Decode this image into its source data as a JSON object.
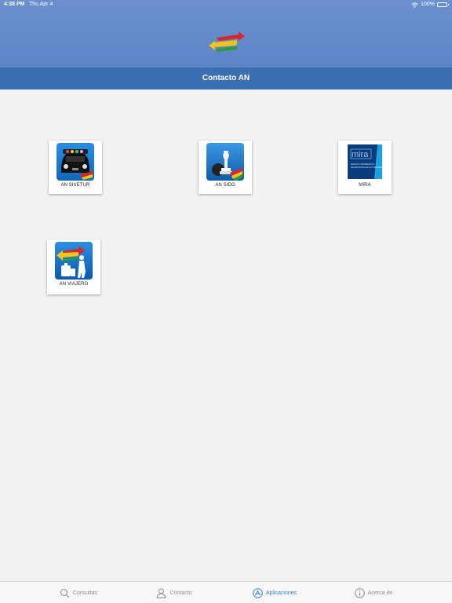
{
  "status": {
    "time": "4:38 PM",
    "date": "Thu Apr 4",
    "battery": "100%"
  },
  "header": {
    "title": "Contacto AN"
  },
  "apps": [
    {
      "label": "AN SIVETUR",
      "icon": "car-icon"
    },
    {
      "label": "AN SIDO",
      "icon": "chess-icon"
    },
    {
      "label": "MIRA",
      "icon": "mira-logo",
      "logo_text": "mira",
      "subtitle_lines": [
        "MODULO INFORMATICO",
        "DE REGISTRO DE ACTUADORES"
      ]
    },
    {
      "label": "AN VIAJERO",
      "icon": "traveler-icon"
    }
  ],
  "tabs": [
    {
      "label": "Consultas",
      "icon": "search-icon",
      "active": false
    },
    {
      "label": "Contacto",
      "icon": "person-icon",
      "active": false
    },
    {
      "label": "Aplicaciones",
      "icon": "apps-icon",
      "active": true
    },
    {
      "label": "Acerca de",
      "icon": "info-icon",
      "active": false
    }
  ],
  "colors": {
    "header": "#6a90cf",
    "titlebar": "#3b6fb4",
    "active_tab": "#3b7fd3",
    "inactive_tab": "#8e8e93",
    "background": "#f2f2f3"
  }
}
